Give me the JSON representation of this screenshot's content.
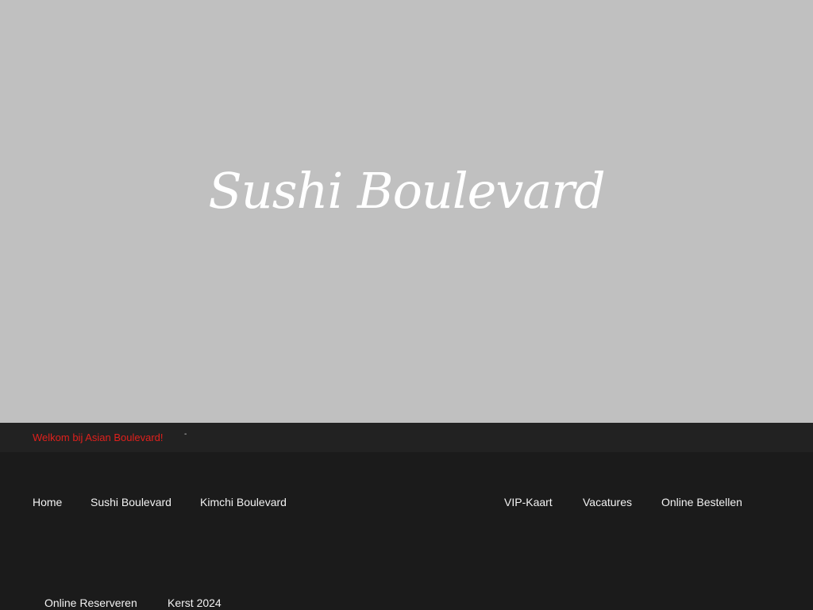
{
  "hero": {
    "title": "Sushi Boulevard"
  },
  "ticker": {
    "message": "Welkom bij Asian Boulevard!",
    "separator": "-"
  },
  "nav": {
    "left": [
      "Home",
      "Sushi Boulevard",
      "Kimchi Boulevard"
    ],
    "right": [
      "VIP-Kaart",
      "Vacatures",
      "Online Bestellen"
    ],
    "second_row": [
      "Online Reserveren",
      "Kerst 2024"
    ]
  },
  "colors": {
    "hero_background": "#c0c0c0",
    "page_background": "#1b1b1b",
    "ticker_background": "#222222",
    "ticker_text": "#e0201c",
    "nav_text": "#f2f2f2"
  }
}
